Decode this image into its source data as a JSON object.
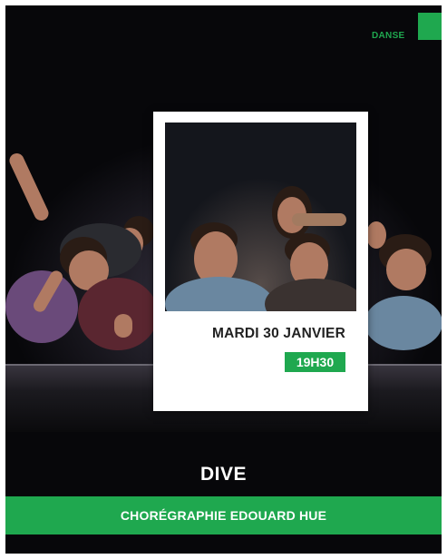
{
  "category": "DANSE",
  "date": "MARDI 30 JANVIER",
  "time": "19H30",
  "title": "DIVE",
  "choreography": "CHORÉGRAPHIE EDOUARD HUE",
  "colors": {
    "accent_green": "#1fa84f",
    "background": "#07070a",
    "card": "#ffffff"
  }
}
